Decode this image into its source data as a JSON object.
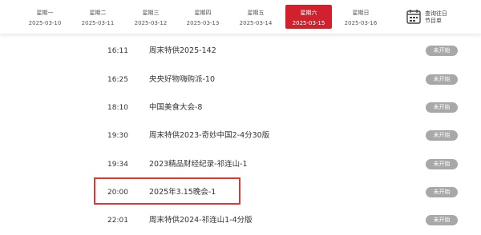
{
  "date_tabs": [
    {
      "weekday": "星期一",
      "date": "2025-03-10"
    },
    {
      "weekday": "星期二",
      "date": "2025-03-11"
    },
    {
      "weekday": "星期三",
      "date": "2025-03-12"
    },
    {
      "weekday": "星期四",
      "date": "2025-03-13"
    },
    {
      "weekday": "星期五",
      "date": "2025-03-14"
    },
    {
      "weekday": "星期六",
      "date": "2025-03-15"
    },
    {
      "weekday": "星期日",
      "date": "2025-03-16"
    }
  ],
  "active_tab_index": 5,
  "history_link": {
    "line1": "查询往日",
    "line2": "节目单",
    "icon": "calendar-icon"
  },
  "programs": [
    {
      "time": "16:11",
      "title": "周末特供2025-142",
      "status": "未开始"
    },
    {
      "time": "16:25",
      "title": "央央好物嗨购派-10",
      "status": "未开始"
    },
    {
      "time": "18:10",
      "title": "中国美食大会-8",
      "status": "未开始"
    },
    {
      "time": "19:30",
      "title": "周末特供2023-奇妙中国2-4分30版",
      "status": "未开始"
    },
    {
      "time": "19:34",
      "title": "2023精品财经纪录-祁连山-1",
      "status": "未开始"
    },
    {
      "time": "20:00",
      "title": "2025年3.15晚会-1",
      "status": "未开始"
    },
    {
      "time": "22:01",
      "title": "周末特供2024-祁连山1-4分版",
      "status": "未开始"
    }
  ],
  "highlighted_index": 5,
  "colors": {
    "accent": "#d0212c",
    "status_badge": "#a8a8a8",
    "highlight_border": "#e2372d"
  }
}
